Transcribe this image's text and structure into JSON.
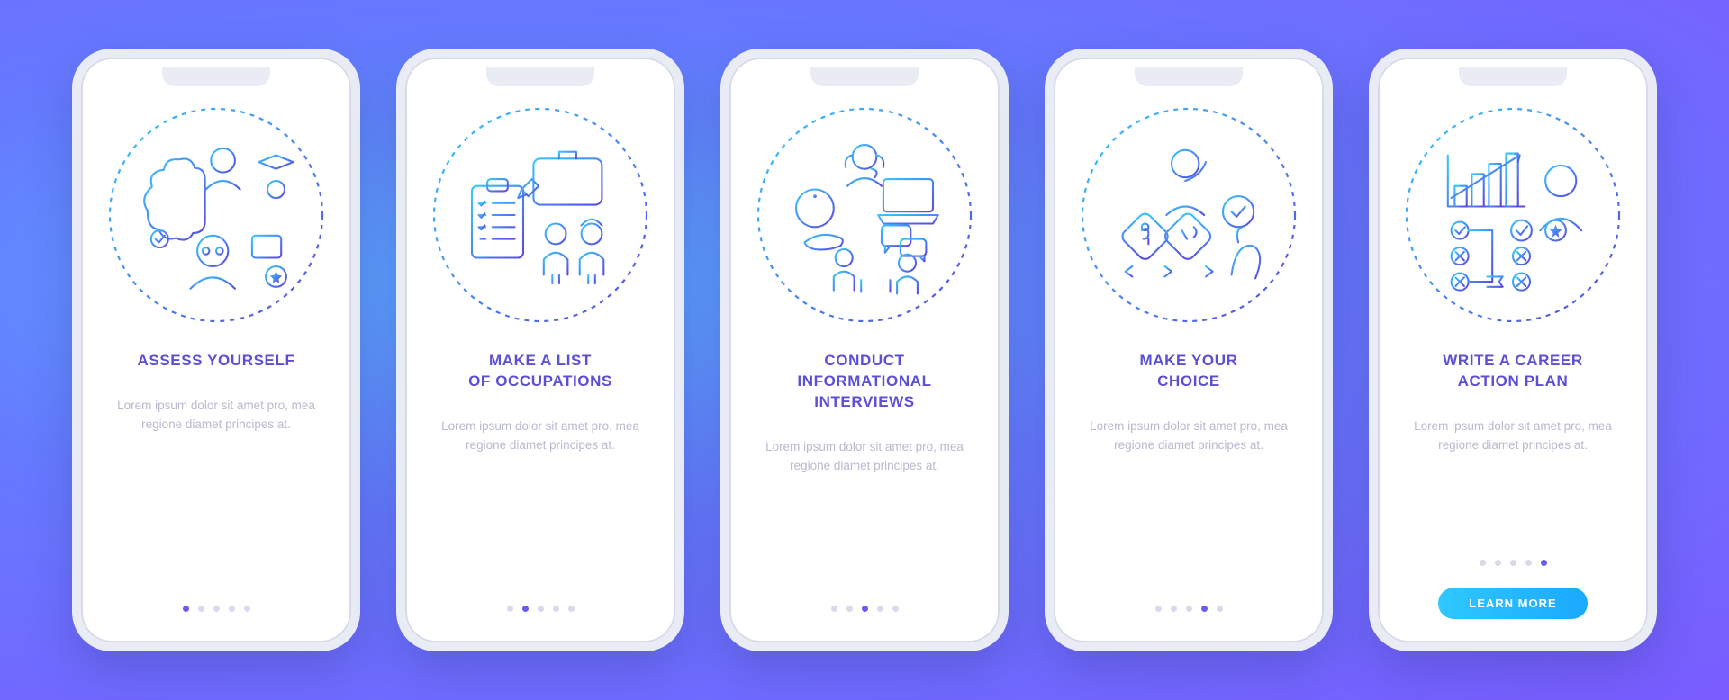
{
  "screens": [
    {
      "title": "ASSESS YOURSELF",
      "desc": "Lorem ipsum dolor sit amet pro, mea regione diamet principes at.",
      "active_dot": 0,
      "cta": null,
      "icon_name": "assess-yourself-icon"
    },
    {
      "title": "MAKE A LIST\nOF OCCUPATIONS",
      "desc": "Lorem ipsum dolor sit amet pro, mea regione diamet principes at.",
      "active_dot": 1,
      "cta": null,
      "icon_name": "list-occupations-icon"
    },
    {
      "title": "CONDUCT\nINFORMATIONAL\nINTERVIEWS",
      "desc": "Lorem ipsum dolor sit amet pro, mea regione diamet principes at.",
      "active_dot": 2,
      "cta": null,
      "icon_name": "informational-interviews-icon"
    },
    {
      "title": "MAKE YOUR\nCHOICE",
      "desc": "Lorem ipsum dolor sit amet pro, mea regione diamet principes at.",
      "active_dot": 3,
      "cta": null,
      "icon_name": "make-choice-icon"
    },
    {
      "title": "WRITE A CAREER\nACTION PLAN",
      "desc": "Lorem ipsum dolor sit amet pro, mea regione diamet principes at.",
      "active_dot": 4,
      "cta": "LEARN MORE",
      "icon_name": "career-action-plan-icon"
    }
  ],
  "dot_count": 5
}
